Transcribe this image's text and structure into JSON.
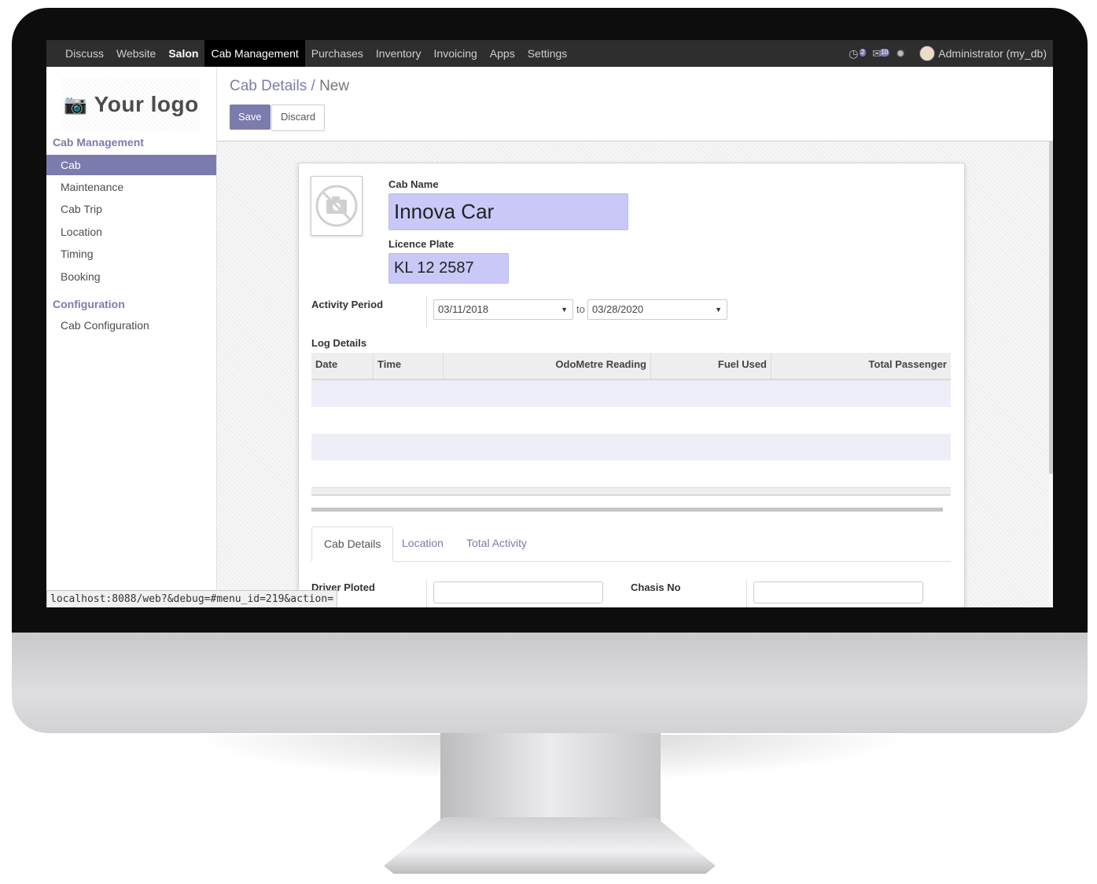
{
  "topbar": {
    "menu": [
      {
        "label": "Discuss",
        "style": "normal"
      },
      {
        "label": "Website",
        "style": "normal"
      },
      {
        "label": "Salon",
        "style": "bold"
      },
      {
        "label": "Cab Management",
        "style": "active"
      },
      {
        "label": "Purchases",
        "style": "normal"
      },
      {
        "label": "Inventory",
        "style": "normal"
      },
      {
        "label": "Invoicing",
        "style": "normal"
      },
      {
        "label": "Apps",
        "style": "normal"
      },
      {
        "label": "Settings",
        "style": "normal"
      }
    ],
    "chat_badge": "2",
    "messages_badge": "10",
    "user": "Administrator (my_db)"
  },
  "sidebar": {
    "logo_text": "Your logo",
    "sections": [
      {
        "title": "Cab Management",
        "items": [
          "Cab",
          "Maintenance",
          "Cab Trip",
          "Location",
          "Timing",
          "Booking"
        ]
      },
      {
        "title": "Configuration",
        "items": [
          "Cab Configuration"
        ]
      }
    ],
    "active_item": "Cab"
  },
  "control": {
    "breadcrumb_parent": "Cab Details",
    "breadcrumb_sep": "/",
    "breadcrumb_current": "New",
    "save_label": "Save",
    "discard_label": "Discard"
  },
  "form": {
    "cab_name_label": "Cab Name",
    "cab_name_value": "Innova Car",
    "licence_label": "Licence Plate",
    "licence_value": "KL 12 2587",
    "activity_label": "Activity Period",
    "date_from": "03/11/2018",
    "date_to": "03/28/2020",
    "to_text": "to",
    "log_label": "Log Details",
    "log_columns": [
      "Date",
      "Time",
      "OdoMetre Reading",
      "Fuel Used",
      "Total Passenger"
    ],
    "tabs": [
      "Cab Details",
      "Location",
      "Total Activity"
    ],
    "active_tab": "Cab Details",
    "driver_label": "Driver Ploted",
    "chasis_label": "Chasis No"
  },
  "status_url": "localhost:8088/web?&debug=#menu_id=219&action="
}
